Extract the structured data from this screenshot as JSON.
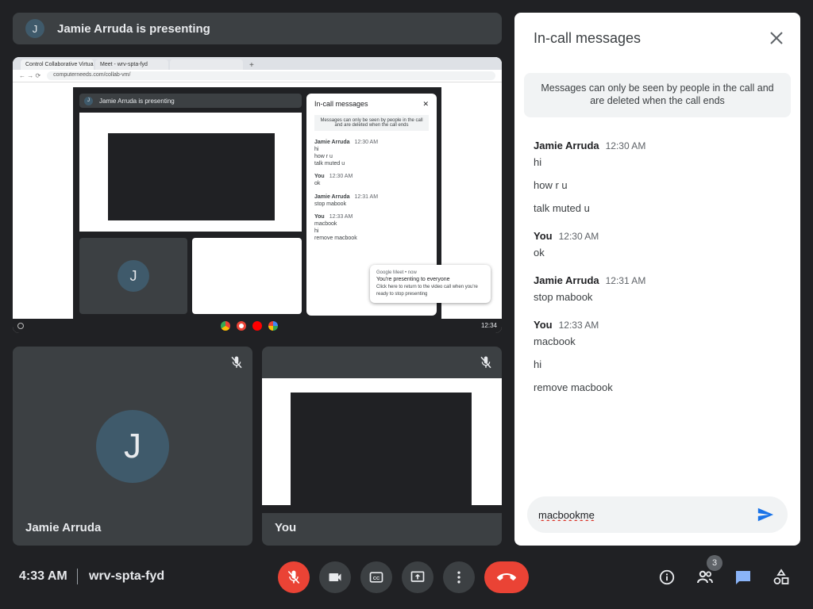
{
  "banner": {
    "avatar_initial": "J",
    "text": "Jamie Arruda is presenting"
  },
  "shared_screen": {
    "tabs": [
      "Control Collaborative Virtual M",
      "Meet - wrv-spta-fyd",
      ""
    ],
    "address": "computerneeds.com/collab-vm/",
    "nested_banner": "Jamie Arruda is presenting",
    "nested_avatar": "J",
    "nested_panel": {
      "title": "In-call messages",
      "note": "Messages can only be seen by people in the call and are deleted when the call ends",
      "messages": [
        {
          "name": "Jamie Arruda",
          "time": "12:30 AM",
          "lines": [
            "hi",
            "how r u",
            "talk muted u"
          ]
        },
        {
          "name": "You",
          "time": "12:30 AM",
          "lines": [
            "ok"
          ]
        },
        {
          "name": "Jamie Arruda",
          "time": "12:31 AM",
          "lines": [
            "stop mabook"
          ]
        },
        {
          "name": "You",
          "time": "12:33 AM",
          "lines": [
            "macbook",
            "hi",
            "remove macbook"
          ]
        }
      ]
    },
    "toast": {
      "source": "Google Meet • now",
      "title": "You're presenting to everyone",
      "body": "Click here to return to the video call when you're ready to stop presenting"
    },
    "tile_initial": "J",
    "shelf_time": "12:34"
  },
  "participants": {
    "left": {
      "name": "Jamie Arruda",
      "initial": "J"
    },
    "right": {
      "name": "You"
    }
  },
  "chat": {
    "title": "In-call messages",
    "note": "Messages can only be seen by people in the call and are deleted when the call ends",
    "groups": [
      {
        "sender": "Jamie Arruda",
        "time": "12:30 AM",
        "lines": [
          "hi",
          "how r u",
          "talk muted u"
        ]
      },
      {
        "sender": "You",
        "time": "12:30 AM",
        "lines": [
          "ok"
        ]
      },
      {
        "sender": "Jamie Arruda",
        "time": "12:31 AM",
        "lines": [
          "stop mabook"
        ]
      },
      {
        "sender": "You",
        "time": "12:33 AM",
        "lines": [
          "macbook",
          "hi",
          "remove macbook"
        ]
      }
    ],
    "composer_value": "macbookme"
  },
  "bottom_bar": {
    "time": "4:33 AM",
    "meeting_code": "wrv-spta-fyd",
    "people_count": "3"
  },
  "colors": {
    "background": "#202124",
    "tile": "#3c4043",
    "accent_blue": "#1a73e8",
    "danger_red": "#ea4335",
    "avatar": "#3f5a6b"
  }
}
